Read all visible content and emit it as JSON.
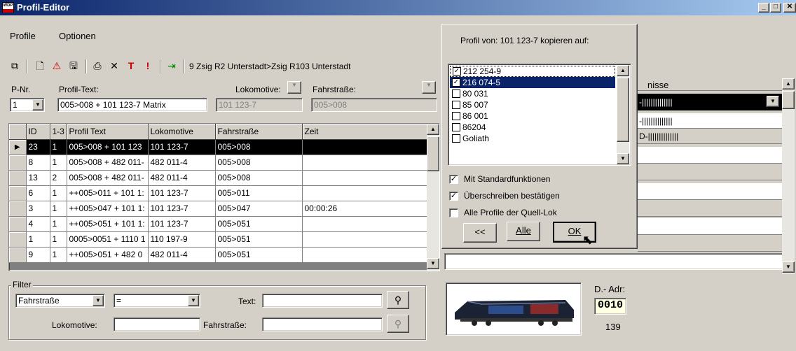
{
  "window": {
    "title": "Profil-Editor",
    "icon_label": "WDP"
  },
  "menu": [
    "Profile",
    "Optionen"
  ],
  "toolbar": {
    "route_text": "9 Zsig R2 Unterstadt>Zsig R103 Unterstadt"
  },
  "fields": {
    "pnr_label": "P-Nr.",
    "pnr_value": "1",
    "profiltext_label": "Profil-Text:",
    "profiltext_value": "005>008 + 101 123-7 Matrix",
    "lok_label": "Lokomotive:",
    "lok_value": "101 123-7",
    "fahr_label": "Fahrstraße:",
    "fahr_value": "005>008"
  },
  "table": {
    "headers": [
      "ID",
      "1-3",
      "Profil Text",
      "Lokomotive",
      "Fahrstraße",
      "Zeit"
    ],
    "rows": [
      [
        "23",
        "1",
        "005>008 + 101 123",
        "101 123-7",
        "005>008",
        ""
      ],
      [
        "8",
        "1",
        "005>008 + 482 011-",
        "482 011-4",
        "005>008",
        ""
      ],
      [
        "13",
        "2",
        "005>008 + 482 011-",
        "482 011-4",
        "005>008",
        ""
      ],
      [
        "6",
        "1",
        "++005>011 + 101 1:",
        "101 123-7",
        "005>011",
        ""
      ],
      [
        "3",
        "1",
        "++005>047 + 101 1:",
        "101 123-7",
        "005>047",
        "00:00:26"
      ],
      [
        "4",
        "1",
        "++005>051 + 101 1:",
        "101 123-7",
        "005>051",
        ""
      ],
      [
        "1",
        "1",
        "0005>0051 + 1110 1",
        "110 197-9",
        "005>051",
        ""
      ],
      [
        "9",
        "1",
        "++005>051 + 482 0",
        "482 011-4",
        "005>051",
        ""
      ]
    ]
  },
  "filter": {
    "label": "Filter",
    "field_value": "Fahrstraße",
    "op_value": "=",
    "text_label": "Text:",
    "lok_label": "Lokomotive:",
    "fahr_label": "Fahrstraße:"
  },
  "right": {
    "header": "nisse",
    "rows": [
      "-||||||||||||||",
      "-||||||||||||||",
      "D-||||||||||||||"
    ],
    "dadr_label": "D.- Adr:",
    "dadr_value": "0010",
    "dadr_sub": "139"
  },
  "popup": {
    "title": "Profil von: 101 123-7 kopieren auf:",
    "items": [
      {
        "label": "212 254-9",
        "checked": true
      },
      {
        "label": "216 074-5",
        "checked": true
      },
      {
        "label": "80 031",
        "checked": false
      },
      {
        "label": "85 007",
        "checked": false
      },
      {
        "label": "86 001",
        "checked": false
      },
      {
        "label": "86204",
        "checked": false
      },
      {
        "label": "Goliath",
        "checked": false
      }
    ],
    "options": [
      {
        "label": "Mit Standardfunktionen",
        "checked": true
      },
      {
        "label": "Überschreiben bestätigen",
        "checked": true
      },
      {
        "label": "Alle Profile der Quell-Lok",
        "checked": false
      }
    ],
    "buttons": {
      "back": "<<",
      "all": "Alle",
      "ok": "OK"
    }
  },
  "check_glyph": "✓"
}
